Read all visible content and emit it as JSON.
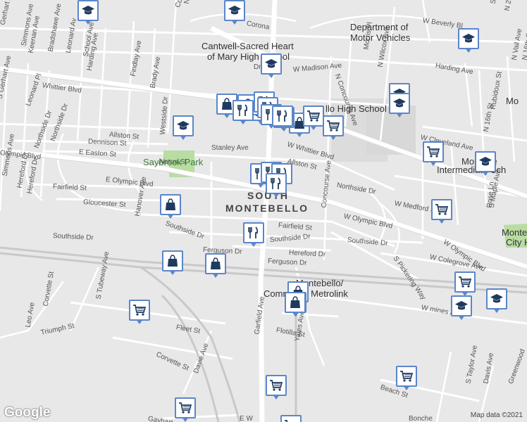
{
  "map": {
    "district_line1": "SOUTH",
    "district_line2": "MONTEBELLO",
    "park_name": "Saybrook Park",
    "poi_labels": [
      {
        "name": "cantwell1",
        "text": "Cantwell-Sacred Heart"
      },
      {
        "name": "cantwell2",
        "text": "of Mary High School"
      },
      {
        "name": "dmv1",
        "text": "Department of"
      },
      {
        "name": "dmv2",
        "text": "Motor Vehicles"
      },
      {
        "name": "highschool",
        "text": "llo High School"
      },
      {
        "name": "intermediate1",
        "text": "Montebe"
      },
      {
        "name": "intermediate2",
        "text": "Intermediate Sch"
      },
      {
        "name": "metrolink1",
        "text": "Montebello/"
      },
      {
        "name": "metrolink2",
        "text": "Commerce Metrolink"
      },
      {
        "name": "montecity1",
        "text": "Monte"
      },
      {
        "name": "montecity2",
        "text": "City H"
      },
      {
        "name": "edge-mo",
        "text": "Mo"
      }
    ],
    "streets": [
      {
        "t": "Whittier Blvd"
      },
      {
        "t": "W Whittier Blvd"
      },
      {
        "t": "E Olympic Blvd"
      },
      {
        "t": "W Olympic Blvd"
      },
      {
        "t": "W Olympic Blvd"
      },
      {
        "t": "Olympic Blvd"
      },
      {
        "t": "Garfield Ave"
      },
      {
        "t": "Ferguson Dr"
      },
      {
        "t": "Ferguson Dr"
      },
      {
        "t": "Southside Dr"
      },
      {
        "t": "Southside Dr"
      },
      {
        "t": "Southside Dr"
      },
      {
        "t": "Southside Dr"
      },
      {
        "t": "Fairfield St"
      },
      {
        "t": "Fairfield St"
      },
      {
        "t": "Gloucester St"
      },
      {
        "t": "Hereford Dr"
      },
      {
        "t": "Hereford Dr"
      },
      {
        "t": "Allston St"
      },
      {
        "t": "Allston St"
      },
      {
        "t": "Dennison St"
      },
      {
        "t": "E Easton St"
      },
      {
        "t": "Northside Dr"
      },
      {
        "t": "Northside Dr"
      },
      {
        "t": "Concourse Ave"
      },
      {
        "t": "N Concourse Ave"
      },
      {
        "t": "W Madison Ave"
      },
      {
        "t": "Harding Ave"
      },
      {
        "t": "Harding Ave"
      },
      {
        "t": "W Beverly Bl"
      },
      {
        "t": "W Cleveland Ave"
      },
      {
        "t": "W Medford St"
      },
      {
        "t": "W Colegrove Ave"
      },
      {
        "t": "W mines Ave"
      },
      {
        "t": "Fleet St"
      },
      {
        "t": "Corvette St"
      },
      {
        "t": "Corvette St"
      },
      {
        "t": "Triumph St"
      },
      {
        "t": "Flotilla St"
      },
      {
        "t": "Yates Ave"
      },
      {
        "t": "Davie Ave"
      },
      {
        "t": "S Tubeway Ave"
      },
      {
        "t": "Hanover Ave"
      },
      {
        "t": "Westside Dr"
      },
      {
        "t": "Findlay Ave"
      },
      {
        "t": "Brady Ave"
      },
      {
        "t": "S Gerhart Ave"
      },
      {
        "t": "Gerhart Ave"
      },
      {
        "t": "Simmons Ave"
      },
      {
        "t": "Simmons Ave"
      },
      {
        "t": "Keenan Ave"
      },
      {
        "t": "Bradshawe Ave"
      },
      {
        "t": "Leonard Av"
      },
      {
        "t": "School Ave"
      },
      {
        "t": "Leonard Pl"
      },
      {
        "t": "Northside Dr"
      },
      {
        "t": "Hereford Dr"
      },
      {
        "t": "Leo Ave"
      },
      {
        "t": "S Pickering Way"
      },
      {
        "t": "Rose Ln"
      },
      {
        "t": "S Maple Ave"
      },
      {
        "t": "N Wilcox Ave"
      },
      {
        "t": "N 21st"
      },
      {
        "t": "Morris Pl"
      },
      {
        "t": "N Vail Ave"
      },
      {
        "t": "N 16th St"
      },
      {
        "t": "Rubidoux St"
      },
      {
        "t": "N 16th St"
      },
      {
        "t": "Beach St"
      },
      {
        "t": "S Taylor Ave"
      },
      {
        "t": "Davis Ave"
      },
      {
        "t": "Greenwood"
      },
      {
        "t": "Gayhart"
      },
      {
        "t": "E W"
      },
      {
        "t": "Corona"
      },
      {
        "t": "Conrad Ave"
      },
      {
        "t": "Dr"
      },
      {
        "t": "Alston St"
      },
      {
        "t": "Stanley Ave"
      },
      {
        "t": "Notre"
      },
      {
        "t": "S 5th St"
      },
      {
        "t": "Bonche"
      }
    ],
    "pins": [
      {
        "icon": "school"
      },
      {
        "icon": "school"
      },
      {
        "icon": "school"
      },
      {
        "icon": "school"
      },
      {
        "icon": "school"
      },
      {
        "icon": "school"
      },
      {
        "icon": "school"
      },
      {
        "icon": "school"
      },
      {
        "icon": "school"
      },
      {
        "icon": "school"
      },
      {
        "icon": "bag"
      },
      {
        "icon": "bag"
      },
      {
        "icon": "bag"
      },
      {
        "icon": "bag"
      },
      {
        "icon": "bag"
      },
      {
        "icon": "bag"
      },
      {
        "icon": "bag"
      },
      {
        "icon": "bag"
      },
      {
        "icon": "bag"
      },
      {
        "icon": "bag"
      },
      {
        "icon": "bag"
      },
      {
        "icon": "food"
      },
      {
        "icon": "food"
      },
      {
        "icon": "food"
      },
      {
        "icon": "food"
      },
      {
        "icon": "food"
      },
      {
        "icon": "food"
      },
      {
        "icon": "food"
      },
      {
        "icon": "food"
      },
      {
        "icon": "food"
      },
      {
        "icon": "food"
      },
      {
        "icon": "cart"
      },
      {
        "icon": "cart"
      },
      {
        "icon": "cart"
      },
      {
        "icon": "cart"
      },
      {
        "icon": "cart"
      },
      {
        "icon": "cart"
      },
      {
        "icon": "cart"
      },
      {
        "icon": "cart"
      },
      {
        "icon": "cart"
      },
      {
        "icon": "cart"
      }
    ],
    "attribution": "Map data ©2021",
    "logo": "Google",
    "colors": {
      "pin_border": "#5b86c9",
      "icon": "#1f3a5f",
      "park": "#b9dca3",
      "road": "#ffffff",
      "major_road": "#ffffff"
    }
  }
}
